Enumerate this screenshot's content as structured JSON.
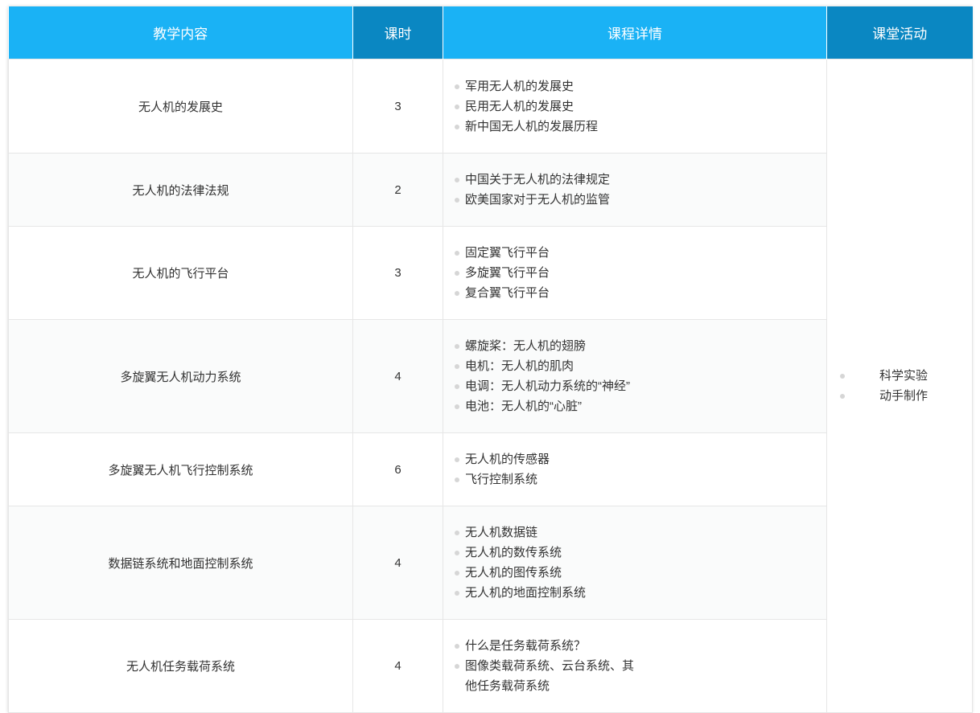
{
  "header": {
    "content": "教学内容",
    "hours": "课时",
    "details": "课程详情",
    "activities": "课堂活动"
  },
  "rows": [
    {
      "content": "无人机的发展史",
      "hours": "3",
      "details": [
        "军用无人机的发展史",
        "民用无人机的发展史",
        "新中国无人机的发展历程"
      ]
    },
    {
      "content": "无人机的法律法规",
      "hours": "2",
      "details": [
        "中国关于无人机的法律规定",
        "欧美国家对于无人机的监管"
      ]
    },
    {
      "content": "无人机的飞行平台",
      "hours": "3",
      "details": [
        "固定翼飞行平台",
        "多旋翼飞行平台",
        "复合翼飞行平台"
      ]
    },
    {
      "content": "多旋翼无人机动力系统",
      "hours": "4",
      "details": [
        "螺旋桨：无人机的翅膀",
        "电机：无人机的肌肉",
        "电调：无人机动力系统的“神经”",
        "电池：无人机的“心脏”"
      ]
    },
    {
      "content": "多旋翼无人机飞行控制系统",
      "hours": "6",
      "details": [
        "无人机的传感器",
        "飞行控制系统"
      ]
    },
    {
      "content": "数据链系统和地面控制系统",
      "hours": "4",
      "details": [
        "无人机数据链",
        "无人机的数传系统",
        "无人机的图传系统",
        "无人机的地面控制系统"
      ]
    },
    {
      "content": "无人机任务载荷系统",
      "hours": "4",
      "details": [
        "什么是任务载荷系统？",
        "图像类载荷系统、云台系统、其他任务载荷系统"
      ]
    }
  ],
  "activities": [
    "科学实验",
    "动手制作"
  ],
  "colors": {
    "header_light": "#1ab2f5",
    "header_dark": "#0a87c2",
    "border": "#e6e6e6",
    "bullet": "#d6d6d6",
    "text": "#333333"
  }
}
